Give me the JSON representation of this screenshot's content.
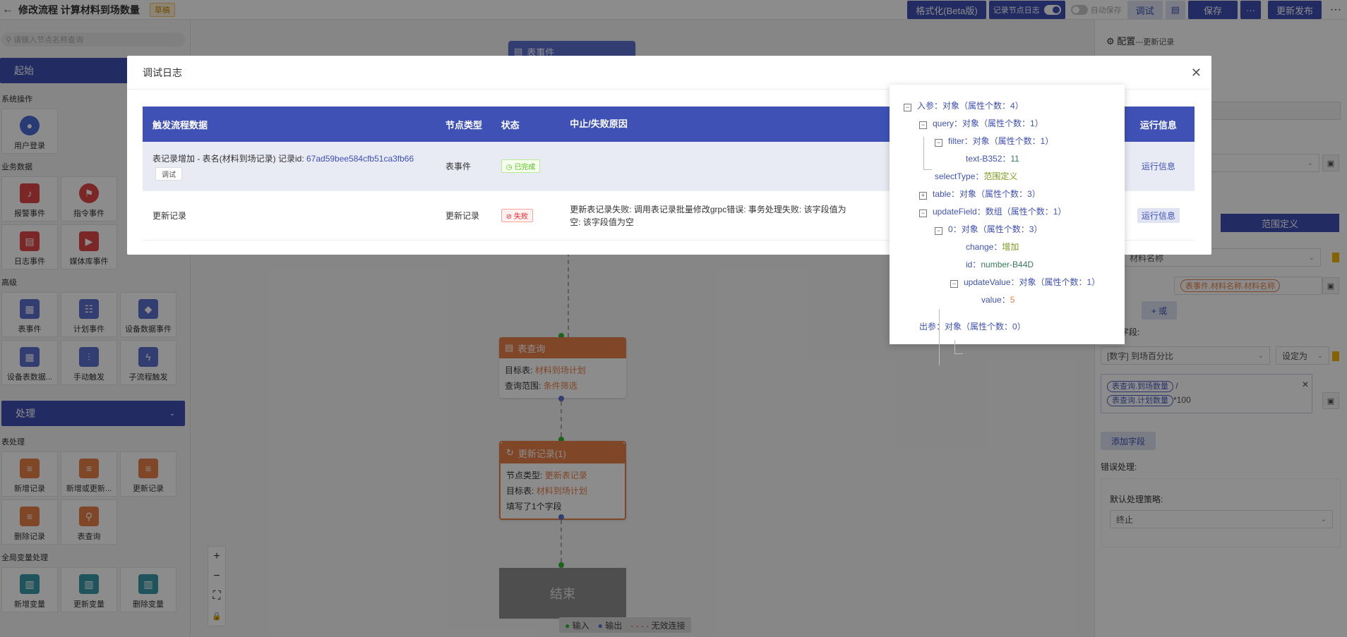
{
  "header": {
    "title": "修改流程 计算材料到场数量",
    "draft": "草稿",
    "format_btn": "格式化(Beta版)",
    "log_toggle": "记录节点日志",
    "autosave": "自动保存",
    "debug_btn": "调试",
    "save_btn": "保存",
    "more_btn": "···",
    "publish_btn": "更新发布",
    "menu_btn": "···"
  },
  "left": {
    "search_placeholder": "请输入节点名称查询",
    "start_label": "起始",
    "process_label": "处理",
    "sections": {
      "system": "系统操作",
      "business": "业务数据",
      "advanced": "高级",
      "table": "表处理",
      "global": "全局变量处理"
    },
    "tiles": {
      "user_login": "用户登录",
      "alarm_event": "报警事件",
      "command_event": "指令事件",
      "log_event": "日志事件",
      "media_event": "媒体库事件",
      "table_event": "表事件",
      "plan_event": "计划事件",
      "device_data_event": "设备数据事件",
      "device_table_data": "设备表数据...",
      "manual_trigger": "手动触发",
      "subflow_trigger": "子流程触发",
      "add_record": "新增记录",
      "add_or_update": "新增或更新...",
      "update_record": "更新记录",
      "delete_record": "删除记录",
      "table_query": "表查询",
      "add_var": "新增变量",
      "update_var": "更新变量",
      "delete_var": "删除变量"
    }
  },
  "canvas": {
    "top_node": "表事件",
    "query_node": {
      "title": "表查询",
      "target_label": "目标表:",
      "target_value": "材料到场计划",
      "range_label": "查询范围:",
      "range_value": "条件筛选"
    },
    "update_node": {
      "title": "更新记录(1)",
      "type_label": "节点类型:",
      "type_value": "更新表记录",
      "target_label": "目标表:",
      "target_value": "材料到场计划",
      "fields": "填写了1个字段"
    },
    "end_node": "结束",
    "zoom": {
      "in": "+",
      "out": "−",
      "fit": "⛶",
      "lock": "🔒"
    },
    "legend": {
      "input": "输入",
      "output": "输出",
      "invalid": "无效连接"
    }
  },
  "right": {
    "title": "配置",
    "subtitle": "---更新记录",
    "range_btn": "范围定义",
    "material_select": "材料名称",
    "material_tag": "表事件.材料名称.材料名称",
    "or_btn": "+ 或",
    "field_label": "字段:",
    "field_select": "[数字] 到场百分比",
    "set_select": "设定为",
    "expr_tag1": "表查询.到场数量",
    "expr_tag2": "表查询.计划数量",
    "expr_slash": "/",
    "expr_suffix": "*100",
    "add_field": "添加字段",
    "error_label": "错误处理:",
    "default_strategy": "默认处理策略:",
    "strategy_value": "终止"
  },
  "modal": {
    "title": "调试日志",
    "columns": [
      "触发流程数据",
      "节点类型",
      "状态",
      "中止/失败原因",
      "运行信息"
    ],
    "rows": [
      {
        "trigger": "表记录增加 - 表名(材料到场记录) 记录id: ",
        "record_id": "67ad59bee584cfb51ca3fb66",
        "debug_tag": "调试",
        "type": "表事件",
        "status": "已完成",
        "reason": "",
        "run_info": "运行信息"
      },
      {
        "trigger": "更新记录",
        "record_id": "",
        "type": "更新记录",
        "status": "失败",
        "reason": "更新表记录失败: 调用表记录批量修改grpc错误: 事务处理失败: 该字段值为空: 该字段值为空",
        "run_info": "运行信息"
      }
    ]
  },
  "json_tree": {
    "input_key": "入参：",
    "input_type": "对象（属性个数：4）",
    "query_key": "query：",
    "query_type": "对象（属性个数：1）",
    "filter_key": "filter：",
    "filter_type": "对象（属性个数：1）",
    "text_key": "text-B352：",
    "text_val": "11",
    "select_key": "selectType：",
    "select_val": "范围定义",
    "table_key": "table：",
    "table_type": "对象（属性个数：3）",
    "update_key": "updateField：",
    "update_type": "数组（属性个数：1）",
    "zero_key": "0：",
    "zero_type": "对象（属性个数：3）",
    "change_key": "change：",
    "change_val": "增加",
    "id_key": "id：",
    "id_val": "number-B44D",
    "uv_key": "updateValue：",
    "uv_type": "对象（属性个数：1）",
    "value_key": "value：",
    "value_val": "5",
    "output_key": "出参：",
    "output_type": "对象（属性个数：0）"
  },
  "colors": {
    "primary": "#3f51b5",
    "node": "#e8814a",
    "success": "#52c41a",
    "danger": "#f5222d"
  }
}
